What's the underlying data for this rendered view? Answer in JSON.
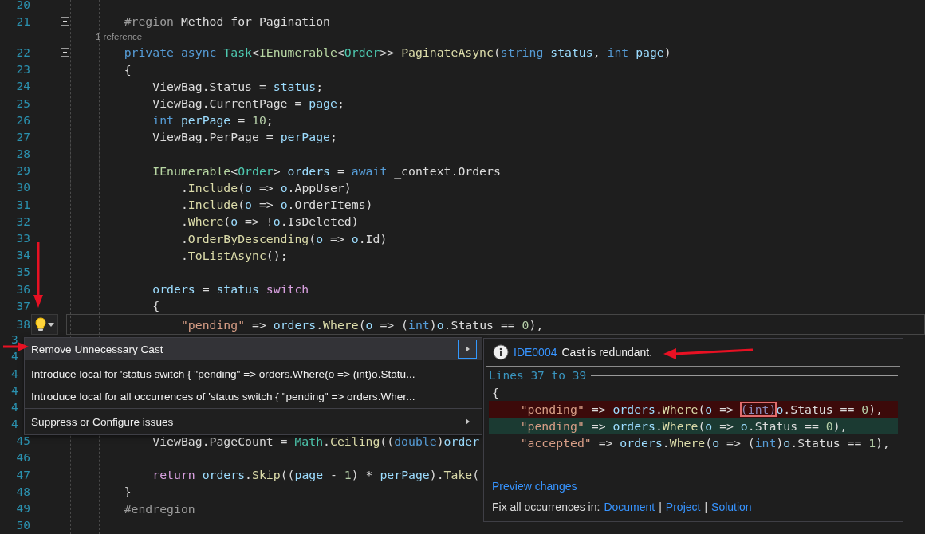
{
  "editor": {
    "lines": [
      {
        "kind": "code",
        "number": "20",
        "fold_box": false,
        "current": false
      },
      {
        "kind": "code",
        "number": "21",
        "fold_box": true,
        "current": false,
        "tokens": [
          {
            "kind": "pre",
            "text": "    #region"
          },
          {
            "kind": "plain",
            "text": " Method for Pagination"
          }
        ]
      },
      {
        "kind": "codelens",
        "text": "1 reference"
      },
      {
        "kind": "code",
        "number": "22",
        "fold_box": true,
        "current": false,
        "tokens": [
          {
            "kind": "kw",
            "text": "    private"
          },
          {
            "kind": "kw",
            "text": " async"
          },
          {
            "kind": "type",
            "text": " Task"
          },
          {
            "kind": "plain",
            "text": "<"
          },
          {
            "kind": "iface",
            "text": "IEnumerable"
          },
          {
            "kind": "plain",
            "text": "<"
          },
          {
            "kind": "type",
            "text": "Order"
          },
          {
            "kind": "plain",
            "text": ">> "
          },
          {
            "kind": "method",
            "text": "PaginateAsync"
          },
          {
            "kind": "plain",
            "text": "("
          },
          {
            "kind": "kw",
            "text": "string"
          },
          {
            "kind": "param",
            "text": " status"
          },
          {
            "kind": "plain",
            "text": ", "
          },
          {
            "kind": "kw",
            "text": "int"
          },
          {
            "kind": "param",
            "text": " page"
          },
          {
            "kind": "plain",
            "text": ")"
          }
        ]
      },
      {
        "kind": "code",
        "number": "23",
        "fold_box": false,
        "current": false,
        "tokens": [
          {
            "kind": "plain",
            "text": "    {"
          }
        ]
      },
      {
        "kind": "code",
        "number": "24",
        "fold_box": false,
        "current": false,
        "tokens": [
          {
            "kind": "plain",
            "text": "        ViewBag.Status = "
          },
          {
            "kind": "param",
            "text": "status"
          },
          {
            "kind": "plain",
            "text": ";"
          }
        ]
      },
      {
        "kind": "code",
        "number": "25",
        "fold_box": false,
        "current": false,
        "tokens": [
          {
            "kind": "plain",
            "text": "        ViewBag.CurrentPage = "
          },
          {
            "kind": "param",
            "text": "page"
          },
          {
            "kind": "plain",
            "text": ";"
          }
        ]
      },
      {
        "kind": "code",
        "number": "26",
        "fold_box": false,
        "current": false,
        "tokens": [
          {
            "kind": "kw",
            "text": "        int"
          },
          {
            "kind": "param",
            "text": " perPage"
          },
          {
            "kind": "plain",
            "text": " = "
          },
          {
            "kind": "num",
            "text": "10"
          },
          {
            "kind": "plain",
            "text": ";"
          }
        ]
      },
      {
        "kind": "code",
        "number": "27",
        "fold_box": false,
        "current": false,
        "tokens": [
          {
            "kind": "plain",
            "text": "        ViewBag.PerPage = "
          },
          {
            "kind": "param",
            "text": "perPage"
          },
          {
            "kind": "plain",
            "text": ";"
          }
        ]
      },
      {
        "kind": "code",
        "number": "28",
        "fold_box": false,
        "current": false
      },
      {
        "kind": "code",
        "number": "29",
        "fold_box": false,
        "current": false,
        "tokens": [
          {
            "kind": "iface",
            "text": "        IEnumerable"
          },
          {
            "kind": "plain",
            "text": "<"
          },
          {
            "kind": "type",
            "text": "Order"
          },
          {
            "kind": "plain",
            "text": "> "
          },
          {
            "kind": "param",
            "text": "orders"
          },
          {
            "kind": "plain",
            "text": " = "
          },
          {
            "kind": "kw",
            "text": "await"
          },
          {
            "kind": "plain",
            "text": " _context.Orders"
          }
        ]
      },
      {
        "kind": "code",
        "number": "30",
        "fold_box": false,
        "current": false,
        "tokens": [
          {
            "kind": "plain",
            "text": "            ."
          },
          {
            "kind": "method",
            "text": "Include"
          },
          {
            "kind": "plain",
            "text": "("
          },
          {
            "kind": "param",
            "text": "o"
          },
          {
            "kind": "plain",
            "text": " => "
          },
          {
            "kind": "param",
            "text": "o"
          },
          {
            "kind": "plain",
            "text": ".AppUser)"
          }
        ]
      },
      {
        "kind": "code",
        "number": "31",
        "fold_box": false,
        "current": false,
        "tokens": [
          {
            "kind": "plain",
            "text": "            ."
          },
          {
            "kind": "method",
            "text": "Include"
          },
          {
            "kind": "plain",
            "text": "("
          },
          {
            "kind": "param",
            "text": "o"
          },
          {
            "kind": "plain",
            "text": " => "
          },
          {
            "kind": "param",
            "text": "o"
          },
          {
            "kind": "plain",
            "text": ".OrderItems)"
          }
        ]
      },
      {
        "kind": "code",
        "number": "32",
        "fold_box": false,
        "current": false,
        "tokens": [
          {
            "kind": "plain",
            "text": "            ."
          },
          {
            "kind": "method",
            "text": "Where"
          },
          {
            "kind": "plain",
            "text": "("
          },
          {
            "kind": "param",
            "text": "o"
          },
          {
            "kind": "plain",
            "text": " => !"
          },
          {
            "kind": "param",
            "text": "o"
          },
          {
            "kind": "plain",
            "text": ".IsDeleted)"
          }
        ]
      },
      {
        "kind": "code",
        "number": "33",
        "fold_box": false,
        "current": false,
        "tokens": [
          {
            "kind": "plain",
            "text": "            ."
          },
          {
            "kind": "method",
            "text": "OrderByDescending"
          },
          {
            "kind": "plain",
            "text": "("
          },
          {
            "kind": "param",
            "text": "o"
          },
          {
            "kind": "plain",
            "text": " => "
          },
          {
            "kind": "param",
            "text": "o"
          },
          {
            "kind": "plain",
            "text": ".Id)"
          }
        ]
      },
      {
        "kind": "code",
        "number": "34",
        "fold_box": false,
        "current": false,
        "tokens": [
          {
            "kind": "plain",
            "text": "            ."
          },
          {
            "kind": "method",
            "text": "ToListAsync"
          },
          {
            "kind": "plain",
            "text": "();"
          }
        ]
      },
      {
        "kind": "code",
        "number": "35",
        "fold_box": false,
        "current": false
      },
      {
        "kind": "code",
        "number": "36",
        "fold_box": false,
        "current": false,
        "tokens": [
          {
            "kind": "param",
            "text": "        orders"
          },
          {
            "kind": "plain",
            "text": " = "
          },
          {
            "kind": "param",
            "text": "status"
          },
          {
            "kind": "ctrl",
            "text": " switch"
          }
        ]
      },
      {
        "kind": "code",
        "number": "37",
        "fold_box": false,
        "current": false,
        "tokens": [
          {
            "kind": "plain",
            "text": "        {"
          }
        ]
      },
      {
        "kind": "code",
        "number": "38",
        "fold_box": false,
        "current": true,
        "tokens": [
          {
            "kind": "str",
            "text": "            \"pending\""
          },
          {
            "kind": "plain",
            "text": " => "
          },
          {
            "kind": "param",
            "text": "orders"
          },
          {
            "kind": "plain",
            "text": "."
          },
          {
            "kind": "method",
            "text": "Where"
          },
          {
            "kind": "plain",
            "text": "("
          },
          {
            "kind": "param",
            "text": "o"
          },
          {
            "kind": "plain",
            "text": " => ("
          },
          {
            "kind": "kw",
            "text": "int"
          },
          {
            "kind": "plain",
            "text": ")"
          },
          {
            "kind": "param",
            "text": "o"
          },
          {
            "kind": "plain",
            "text": ".Status == "
          },
          {
            "kind": "num",
            "text": "0"
          },
          {
            "kind": "plain",
            "text": "),"
          }
        ]
      },
      {
        "kind": "code",
        "number": "3",
        "fold_box": false,
        "current": false
      },
      {
        "kind": "code",
        "number": "4",
        "fold_box": false,
        "current": false
      },
      {
        "kind": "code",
        "number": "4",
        "fold_box": false,
        "current": false
      },
      {
        "kind": "code",
        "number": "4",
        "fold_box": false,
        "current": false
      },
      {
        "kind": "code",
        "number": "4",
        "fold_box": false,
        "current": false
      },
      {
        "kind": "code",
        "number": "4",
        "fold_box": false,
        "current": false
      },
      {
        "kind": "code",
        "number": "45",
        "fold_box": false,
        "current": false,
        "tokens": [
          {
            "kind": "plain",
            "text": "        ViewBag.PageCount = "
          },
          {
            "kind": "type",
            "text": "Math"
          },
          {
            "kind": "plain",
            "text": "."
          },
          {
            "kind": "method",
            "text": "Ceiling"
          },
          {
            "kind": "plain",
            "text": "(("
          },
          {
            "kind": "kw",
            "text": "double"
          },
          {
            "kind": "plain",
            "text": ")"
          },
          {
            "kind": "param",
            "text": "order"
          }
        ]
      },
      {
        "kind": "code",
        "number": "46",
        "fold_box": false,
        "current": false
      },
      {
        "kind": "code",
        "number": "47",
        "fold_box": false,
        "current": false,
        "tokens": [
          {
            "kind": "ctrl",
            "text": "        return"
          },
          {
            "kind": "param",
            "text": " orders"
          },
          {
            "kind": "plain",
            "text": "."
          },
          {
            "kind": "method",
            "text": "Skip"
          },
          {
            "kind": "plain",
            "text": "(("
          },
          {
            "kind": "param",
            "text": "page"
          },
          {
            "kind": "plain",
            "text": " - "
          },
          {
            "kind": "num",
            "text": "1"
          },
          {
            "kind": "plain",
            "text": ") * "
          },
          {
            "kind": "param",
            "text": "perPage"
          },
          {
            "kind": "plain",
            "text": ")."
          },
          {
            "kind": "method",
            "text": "Take"
          },
          {
            "kind": "plain",
            "text": "("
          }
        ]
      },
      {
        "kind": "code",
        "number": "48",
        "fold_box": false,
        "current": false,
        "tokens": [
          {
            "kind": "plain",
            "text": "    }"
          }
        ]
      },
      {
        "kind": "code",
        "number": "49",
        "fold_box": false,
        "current": false,
        "tokens": [
          {
            "kind": "pre",
            "text": "    #endregion"
          }
        ]
      },
      {
        "kind": "code",
        "number": "50",
        "fold_box": false,
        "current": false
      }
    ]
  },
  "quick_actions_menu": {
    "items": [
      {
        "label": "Remove Unnecessary Cast",
        "selected": true,
        "submenu": true,
        "separator_before": false
      },
      {
        "label": "Introduce local for 'status switch { \"pending\" => orders.Where(o => (int)o.Statu...",
        "selected": false,
        "submenu": false,
        "separator_before": false
      },
      {
        "label": "Introduce local for all occurrences of 'status switch { \"pending\" => orders.Wher...",
        "selected": false,
        "submenu": false,
        "separator_before": false
      },
      {
        "label": "Suppress or Configure issues",
        "selected": false,
        "submenu": true,
        "separator_before": true
      }
    ]
  },
  "preview_panel": {
    "diagnostic_id": "IDE0004",
    "message": "Cast is redundant.",
    "range_label": "Lines 37 to 39",
    "lines": [
      {
        "kind": "context",
        "tokens": [
          {
            "kind": "plain",
            "text": "{"
          }
        ]
      },
      {
        "kind": "removed",
        "tokens": [
          {
            "kind": "str",
            "text": "    \"pending\""
          },
          {
            "kind": "plain",
            "text": " => "
          },
          {
            "kind": "param",
            "text": "orders"
          },
          {
            "kind": "plain",
            "text": "."
          },
          {
            "kind": "method",
            "text": "Where"
          },
          {
            "kind": "plain",
            "text": "("
          },
          {
            "kind": "param",
            "text": "o"
          },
          {
            "kind": "plain",
            "text": " => "
          },
          {
            "kind": "cast",
            "text": "(int)"
          },
          {
            "kind": "param",
            "text": "o"
          },
          {
            "kind": "plain",
            "text": ".Status == "
          },
          {
            "kind": "num",
            "text": "0"
          },
          {
            "kind": "plain",
            "text": "),"
          }
        ]
      },
      {
        "kind": "added",
        "tokens": [
          {
            "kind": "str",
            "text": "    \"pending\""
          },
          {
            "kind": "plain",
            "text": " => "
          },
          {
            "kind": "param",
            "text": "orders"
          },
          {
            "kind": "plain",
            "text": "."
          },
          {
            "kind": "method",
            "text": "Where"
          },
          {
            "kind": "plain",
            "text": "("
          },
          {
            "kind": "param",
            "text": "o"
          },
          {
            "kind": "plain",
            "text": " => "
          },
          {
            "kind": "param",
            "text": "o"
          },
          {
            "kind": "plain",
            "text": ".Status == "
          },
          {
            "kind": "num",
            "text": "0"
          },
          {
            "kind": "plain",
            "text": "),"
          }
        ]
      },
      {
        "kind": "context",
        "tokens": [
          {
            "kind": "str",
            "text": "    \"accepted\""
          },
          {
            "kind": "plain",
            "text": " => "
          },
          {
            "kind": "param",
            "text": "orders"
          },
          {
            "kind": "plain",
            "text": "."
          },
          {
            "kind": "method",
            "text": "Where"
          },
          {
            "kind": "plain",
            "text": "("
          },
          {
            "kind": "param",
            "text": "o"
          },
          {
            "kind": "plain",
            "text": " => ("
          },
          {
            "kind": "kw",
            "text": "int"
          },
          {
            "kind": "plain",
            "text": ")"
          },
          {
            "kind": "param",
            "text": "o"
          },
          {
            "kind": "plain",
            "text": ".Status == "
          },
          {
            "kind": "num",
            "text": "1"
          },
          {
            "kind": "plain",
            "text": "),"
          }
        ]
      }
    ],
    "preview_link": "Preview changes",
    "fix_all_label": "Fix all occurrences in:",
    "fix_all_scopes": [
      {
        "name": "Document"
      },
      {
        "divider": "|",
        "name": "Project"
      },
      {
        "divider": "|",
        "name": "Solution"
      }
    ]
  }
}
